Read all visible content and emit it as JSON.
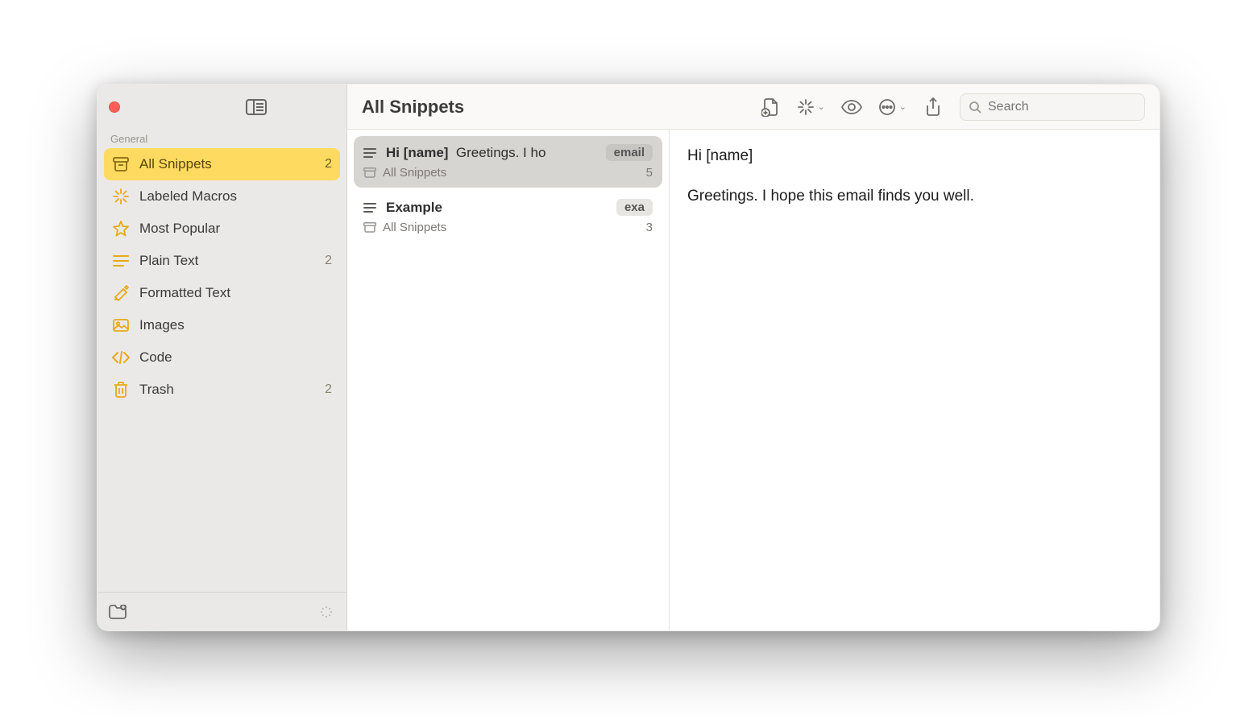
{
  "colors": {
    "accent": "#fedb60",
    "icon_accent": "#e8a919"
  },
  "sidebar": {
    "section_label": "General",
    "items": [
      {
        "icon": "archive",
        "label": "All Snippets",
        "count": "2",
        "selected": true
      },
      {
        "icon": "sparkle",
        "label": "Labeled Macros",
        "count": ""
      },
      {
        "icon": "star",
        "label": "Most Popular",
        "count": ""
      },
      {
        "icon": "lines",
        "label": "Plain Text",
        "count": "2"
      },
      {
        "icon": "formatted",
        "label": "Formatted Text",
        "count": ""
      },
      {
        "icon": "image",
        "label": "Images",
        "count": ""
      },
      {
        "icon": "code",
        "label": "Code",
        "count": ""
      },
      {
        "icon": "trash",
        "label": "Trash",
        "count": "2"
      }
    ]
  },
  "toolbar": {
    "title": "All Snippets",
    "search_placeholder": "Search"
  },
  "snippets": [
    {
      "title": "Hi [name]",
      "preview": "Greetings. I ho",
      "badge": "email",
      "folder": "All Snippets",
      "count": "5",
      "selected": true
    },
    {
      "title": "Example",
      "preview": "",
      "badge": "exa",
      "folder": "All Snippets",
      "count": "3",
      "selected": false
    }
  ],
  "detail": {
    "line1": "Hi [name]",
    "line2": "Greetings. I hope this email finds you well."
  }
}
